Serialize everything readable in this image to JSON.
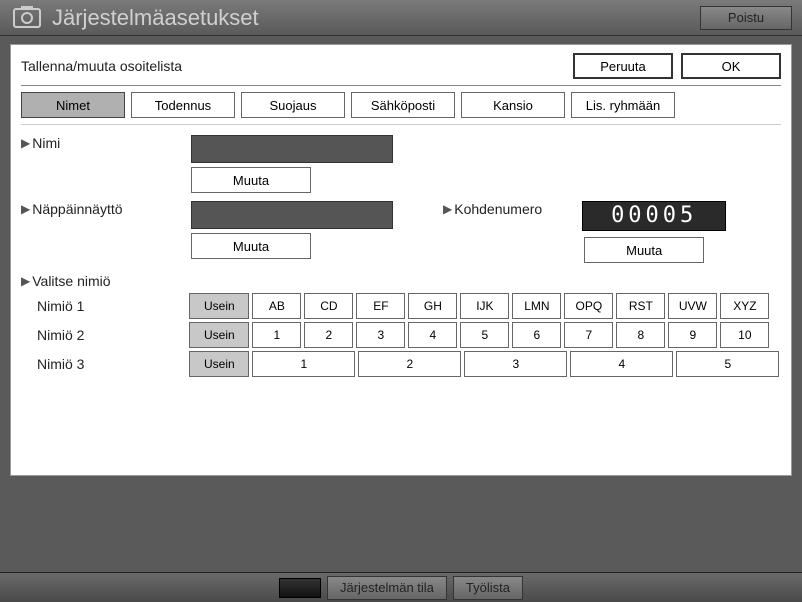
{
  "titlebar": {
    "title": "Järjestelmäasetukset",
    "exit": "Poistu"
  },
  "panel": {
    "subtitle": "Tallenna/muuta osoitelista",
    "cancel": "Peruuta",
    "ok": "OK"
  },
  "tabs": [
    "Nimet",
    "Todennus",
    "Suojaus",
    "Sähköposti",
    "Kansio",
    "Lis. ryhmään"
  ],
  "active_tab": 0,
  "form": {
    "name_label": "Nimi",
    "name_value": "",
    "change": "Muuta",
    "keydisplay_label": "Näppäinnäyttö",
    "keydisplay_value": "",
    "dest_label": "Kohdenumero",
    "dest_value": "00005"
  },
  "groups": {
    "header": "Valitse nimiö",
    "rows": [
      {
        "label": "Nimiö 1",
        "often": "Usein",
        "cells": [
          "AB",
          "CD",
          "EF",
          "GH",
          "IJK",
          "LMN",
          "OPQ",
          "RST",
          "UVW",
          "XYZ"
        ]
      },
      {
        "label": "Nimiö 2",
        "often": "Usein",
        "cells": [
          "1",
          "2",
          "3",
          "4",
          "5",
          "6",
          "7",
          "8",
          "9",
          "10"
        ]
      },
      {
        "label": "Nimiö 3",
        "often": "Usein",
        "cells": [
          "1",
          "2",
          "3",
          "4",
          "5"
        ]
      }
    ]
  },
  "footer": {
    "status": "Järjestelmän tila",
    "joblist": "Työlista"
  }
}
